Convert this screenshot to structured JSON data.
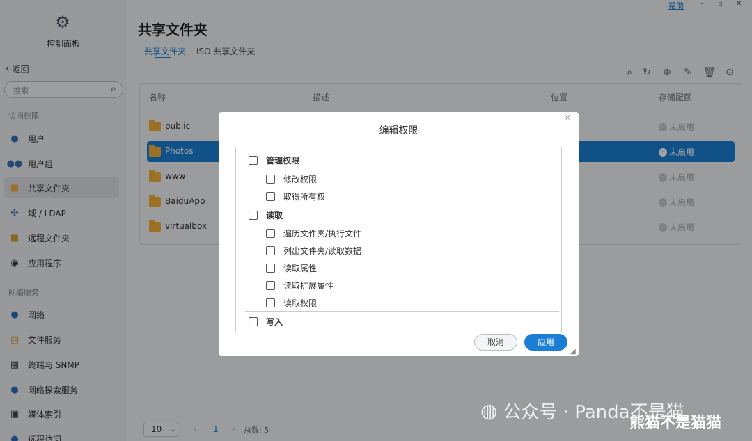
{
  "window": {
    "help": "帮助",
    "minimize": "–",
    "restore": "▫",
    "close": "✕"
  },
  "sidebar": {
    "control_panel": "控制面板",
    "back": "返回",
    "search_placeholder": "搜索",
    "section_access": "访问权限",
    "section_network": "网络服务",
    "items": [
      {
        "label": "用户",
        "icon": "user-icon"
      },
      {
        "label": "用户组",
        "icon": "users-icon"
      },
      {
        "label": "共享文件夹",
        "icon": "folder-icon",
        "selected": true
      },
      {
        "label": "域 / LDAP",
        "icon": "domain-icon"
      },
      {
        "label": "远程文件夹",
        "icon": "remote-folder-icon"
      },
      {
        "label": "应用程序",
        "icon": "app-icon"
      },
      {
        "label": "网络",
        "icon": "globe-icon"
      },
      {
        "label": "文件服务",
        "icon": "file-service-icon"
      },
      {
        "label": "终端与 SNMP",
        "icon": "terminal-icon"
      },
      {
        "label": "网络探索服务",
        "icon": "discovery-icon"
      },
      {
        "label": "媒体索引",
        "icon": "media-index-icon"
      },
      {
        "label": "远程访问",
        "icon": "remote-access-icon"
      }
    ]
  },
  "main": {
    "title": "共享文件夹",
    "tabs": [
      "共享文件夹",
      "ISO 共享文件夹"
    ],
    "columns": [
      "名称",
      "描述",
      "位置",
      "存储配额"
    ],
    "rows": [
      {
        "name": "public",
        "quota": "未启用"
      },
      {
        "name": "Photos",
        "quota": "未启用",
        "selected": true
      },
      {
        "name": "www",
        "quota": "未启用"
      },
      {
        "name": "BaiduApp",
        "quota": "未启用"
      },
      {
        "name": "virtualbox",
        "quota": "未启用"
      }
    ],
    "pager": {
      "per_page": "10",
      "page": "1",
      "total": "总数: 5"
    }
  },
  "dialog": {
    "title": "编辑权限",
    "close": "×",
    "groups": [
      {
        "label": "管理权限",
        "items": [
          "修改权限",
          "取得所有权"
        ]
      },
      {
        "label": "读取",
        "items": [
          "遍历文件夹/执行文件",
          "列出文件夹/读取数据",
          "读取属性",
          "读取扩展属性",
          "读取权限"
        ]
      },
      {
        "label": "写入",
        "items": []
      }
    ],
    "cancel": "取消",
    "apply": "应用"
  },
  "watermark": {
    "text": "公众号 · Panda不是猫",
    "overlay": "熊猫不是猫猫"
  },
  "colors": {
    "accent": "#1a7fd4",
    "folder": "#f2b13a"
  }
}
